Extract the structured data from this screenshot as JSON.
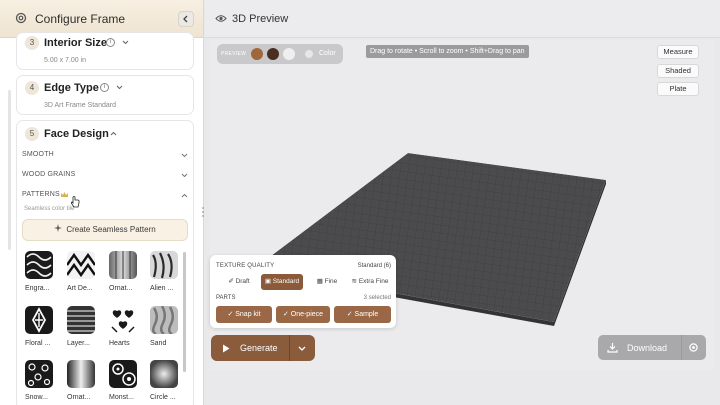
{
  "left_panel": {
    "title": "Configure Frame",
    "steps": [
      {
        "num": "3",
        "title": "Interior Size",
        "sub": "5.00 x 7.00 in"
      },
      {
        "num": "4",
        "title": "Edge Type",
        "sub": "3D Art Frame Standard"
      },
      {
        "num": "5",
        "title": "Face Design"
      }
    ],
    "sections": {
      "smooth": "SMOOTH",
      "wood": "WOOD GRAINS",
      "patterns": "PATTERNS",
      "patterns_sub": "Seamless color tile"
    },
    "create_button": "Create Seamless Pattern",
    "patterns": [
      {
        "label": "Engra..."
      },
      {
        "label": "Art De..."
      },
      {
        "label": "Ornat..."
      },
      {
        "label": "Alien ..."
      },
      {
        "label": "Floral ..."
      },
      {
        "label": "Layer..."
      },
      {
        "label": "Hearts"
      },
      {
        "label": "Sand"
      },
      {
        "label": "Snow..."
      },
      {
        "label": "Ornat..."
      },
      {
        "label": "Monst..."
      },
      {
        "label": "Circle ..."
      }
    ]
  },
  "preview": {
    "title": "3D Preview",
    "pill_label": "PREVIEW",
    "color_label": "Color",
    "swatch_colors": [
      "#a0673b",
      "#4a2e22",
      "#efefef"
    ],
    "hint": "Drag to rotate • Scroll to zoom • Shift+Drag to pan",
    "buttons": [
      "Measure",
      "Shaded",
      "Plate"
    ]
  },
  "quality": {
    "title": "TEXTURE QUALITY",
    "value": "Standard (6)",
    "options": [
      "Draft",
      "Standard",
      "Fine",
      "Extra Fine"
    ],
    "parts_title": "PARTS",
    "parts_count": "3 selected",
    "parts": [
      "Snap kit",
      "One-piece",
      "Sample"
    ]
  },
  "actions": {
    "generate": "Generate",
    "download": "Download"
  },
  "colors": {
    "accent": "#8a5c3c",
    "plane": "#4b4b4d"
  }
}
